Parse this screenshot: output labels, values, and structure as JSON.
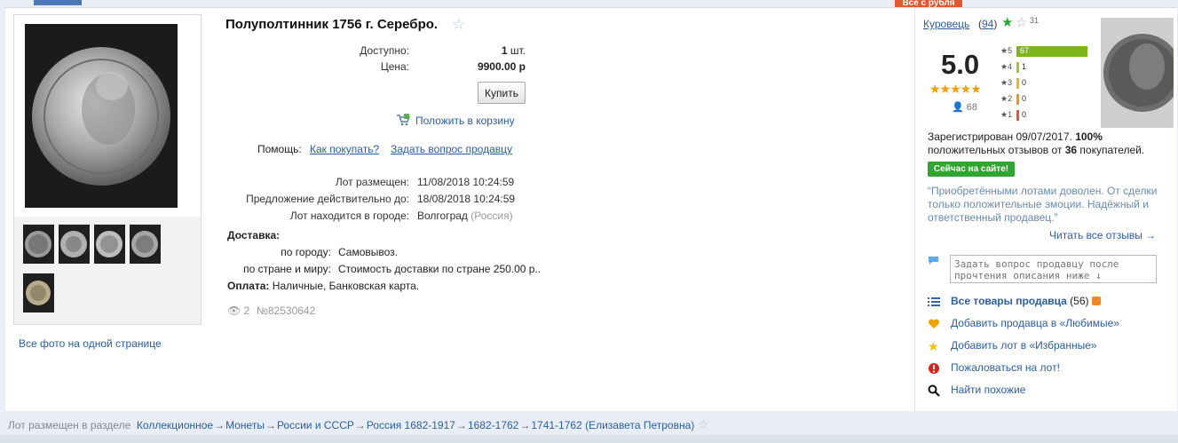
{
  "promo_badge": "Все с рубля",
  "lot": {
    "title": "Полуполтинник 1756 г. Серебро.",
    "available_label": "Доступно:",
    "available_value": "1",
    "available_unit": "шт.",
    "price_label": "Цена:",
    "price_value": "9900.00 р",
    "buy_label": "Купить",
    "cart_label": "Положить в корзину",
    "help_label": "Помощь:",
    "help_how": "Как покупать?",
    "help_ask": "Задать вопрос продавцу",
    "placed_label": "Лот размещен:",
    "placed_value": "11/08/2018 10:24:59",
    "valid_label": "Предложение действительно до:",
    "valid_value": "18/08/2018 10:24:59",
    "city_label": "Лот находится в городе:",
    "city_value": "Волгоград",
    "country_value": "(Россия)",
    "delivery_title": "Доставка:",
    "city_delivery_label": "по городу:",
    "city_delivery_value": "Самовывоз.",
    "country_delivery_label": "по стране и миру:",
    "country_delivery_value": "Стоимость доставки по стране 250.00 р..",
    "payment_label": "Оплата:",
    "payment_value": "Наличные, Банковская карта.",
    "views": "2",
    "lot_number": "№82530642"
  },
  "gallery": {
    "all_photos_link": "Все фото на одной странице"
  },
  "seller": {
    "name": "Куровець",
    "count_open": "(",
    "count": "94",
    "count_close": ")",
    "stars_count": "31",
    "rating": "5.0",
    "rating_stars": "★★★★★",
    "people_count": "68",
    "bars": [
      {
        "label": "★5",
        "value": "67",
        "fraction": 1.0,
        "color": "#7cb518"
      },
      {
        "label": "★4",
        "value": "1",
        "fraction": 0.02,
        "color": "#a3c423"
      },
      {
        "label": "★3",
        "value": "0",
        "fraction": 0.0,
        "color": "#f2b705"
      },
      {
        "label": "★2",
        "value": "0",
        "fraction": 0.0,
        "color": "#f29a05"
      },
      {
        "label": "★1",
        "value": "0",
        "fraction": 0.0,
        "color": "#e4572e"
      }
    ],
    "registered_text": "Зарегистрирован 09/07/2017.",
    "positive_percent": "100%",
    "positive_text": "положительных отзывов от",
    "buyers_count": "36",
    "buyers_text": "покупателей.",
    "online_badge": "Сейчас на сайте!",
    "review_quote": "“Приобретёнными лотами доволен. От сделки только положительные эмоции. Надёжный и ответственный продавец.”",
    "read_all": "Читать все отзывы →",
    "ask_placeholder": "Задать вопрос продавцу после прочтения описания ниже ↓",
    "all_goods_label": "Все товары продавца",
    "all_goods_count": "(56)",
    "add_favorite_seller": "Добавить продавца в «Любимые»",
    "add_favorite_lot": "Добавить лот в «Избранные»",
    "complain": "Пожаловаться на лот!",
    "find_similar": "Найти похожие"
  },
  "breadcrumb": {
    "prefix": "Лот размещен в разделе",
    "items": [
      "Коллекционное",
      "Монеты",
      "России и СССР",
      "Россия 1682-1917",
      "1682-1762",
      "1741-1762 (Елизавета Петровна)"
    ],
    "separator": "→"
  },
  "colors": {
    "link": "#2a5ea8",
    "accent": "#e4572e",
    "online": "#2fa62f",
    "star": "#f2a100"
  }
}
